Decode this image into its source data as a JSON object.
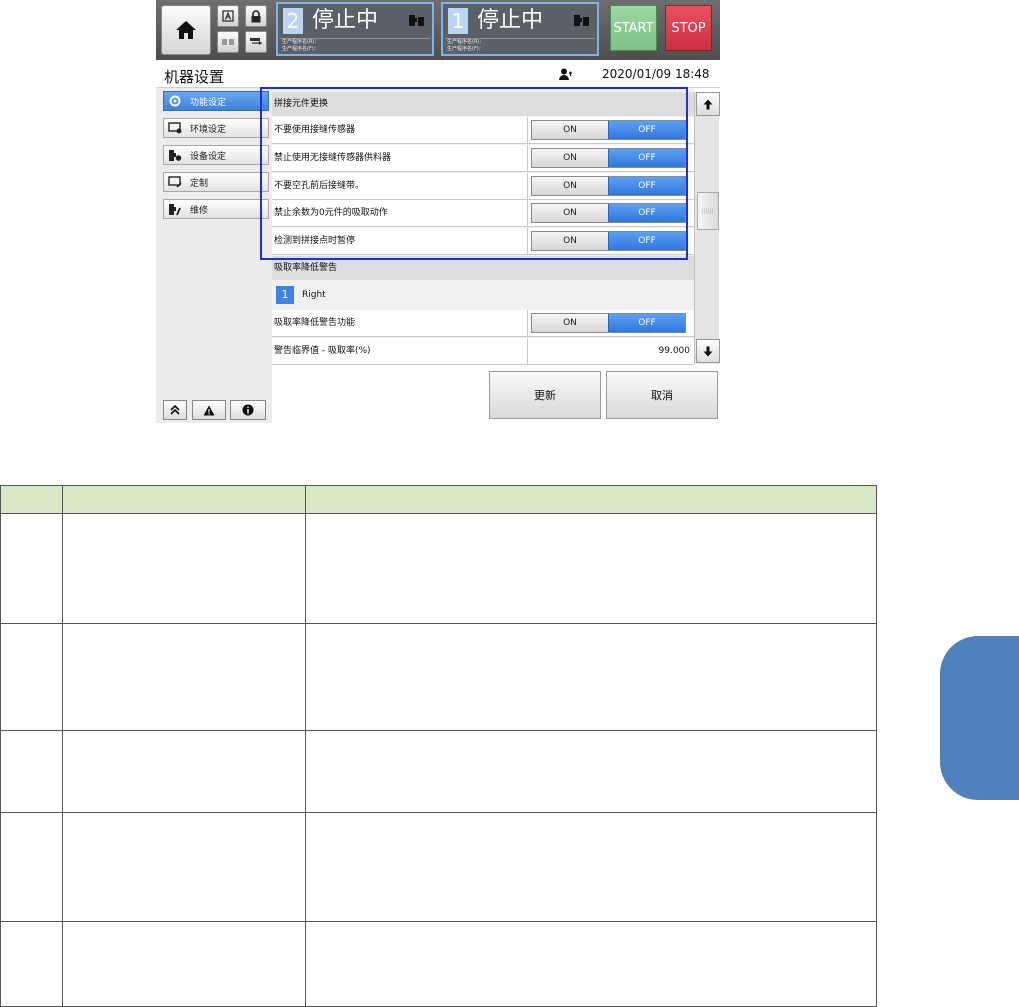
{
  "header": {
    "lanes": [
      {
        "number": "2",
        "status": "停止中",
        "program_rear": "生产程序名(R)：",
        "program_front": "生产程序名(F)："
      },
      {
        "number": "1",
        "status": "停止中",
        "program_rear": "生产程序名(R)：",
        "program_front": "生产程序名(F)："
      }
    ],
    "start_label": "START",
    "stop_label": "STOP"
  },
  "titlebar": {
    "title": "机器设置",
    "datetime": "2020/01/09 18:48"
  },
  "sidebar": {
    "items": [
      {
        "label": "功能设定",
        "icon": "gear-icon",
        "active": true
      },
      {
        "label": "环境设定",
        "icon": "monitor-gear-icon",
        "active": false
      },
      {
        "label": "设备设定",
        "icon": "machine-gear-icon",
        "active": false
      },
      {
        "label": "定制",
        "icon": "monitor-edit-icon",
        "active": false
      },
      {
        "label": "维修",
        "icon": "machine-wrench-icon",
        "active": false
      }
    ]
  },
  "content": {
    "section1_header": "拼接元件更换",
    "rows1": [
      {
        "label": "不要使用接缝传感器",
        "on": "ON",
        "off": "OFF"
      },
      {
        "label": "禁止使用无接缝传感器供料器",
        "on": "ON",
        "off": "OFF"
      },
      {
        "label": "不要空孔前后接缝带。",
        "on": "ON",
        "off": "OFF"
      },
      {
        "label": "禁止余数为0元件的吸取动作",
        "on": "ON",
        "off": "OFF"
      },
      {
        "label": "检测到拼接点时暂停",
        "on": "ON",
        "off": "OFF"
      }
    ],
    "section2_header": "吸取率降低警告",
    "lane_number": "1",
    "lane_name": "Right",
    "row_warn": {
      "label": "吸取率降低警告功能",
      "on": "ON",
      "off": "OFF"
    },
    "row_threshold": {
      "label": "警告临界值 - 吸取率(%)",
      "value": "99.000"
    }
  },
  "actions": {
    "update": "更新",
    "cancel": "取消"
  },
  "colors": {
    "accent_blue": "#3b82dc",
    "highlight_box": "#1f2ee6",
    "table_header": "#d9e8c4",
    "side_tab": "#4f81bd"
  }
}
